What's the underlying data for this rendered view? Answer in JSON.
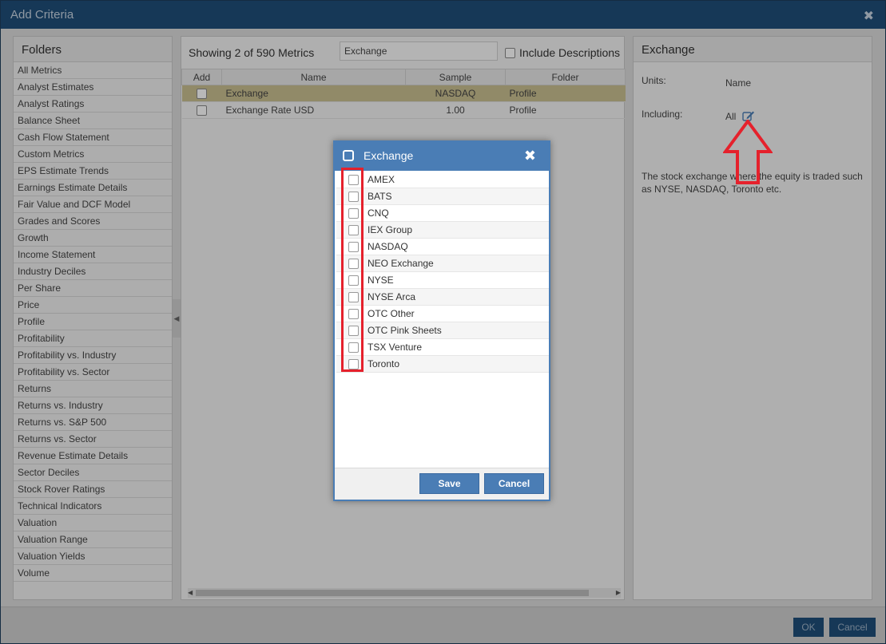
{
  "window": {
    "title": "Add Criteria"
  },
  "folders": {
    "title": "Folders",
    "items": [
      "All Metrics",
      "Analyst Estimates",
      "Analyst Ratings",
      "Balance Sheet",
      "Cash Flow Statement",
      "Custom Metrics",
      "EPS Estimate Trends",
      "Earnings Estimate Details",
      "Fair Value and DCF Model",
      "Grades and Scores",
      "Growth",
      "Income Statement",
      "Industry Deciles",
      "Per Share",
      "Price",
      "Profile",
      "Profitability",
      "Profitability vs. Industry",
      "Profitability vs. Sector",
      "Returns",
      "Returns vs. Industry",
      "Returns vs. S&P 500",
      "Returns vs. Sector",
      "Revenue Estimate Details",
      "Sector Deciles",
      "Stock Rover Ratings",
      "Technical Indicators",
      "Valuation",
      "Valuation Range",
      "Valuation Yields",
      "Volume"
    ]
  },
  "metrics": {
    "showing": "Showing 2 of 590 Metrics",
    "search_value": "Exchange",
    "include_descriptions": "Include Descriptions",
    "columns": {
      "add": "Add",
      "name": "Name",
      "sample": "Sample",
      "folder": "Folder"
    },
    "rows": [
      {
        "name": "Exchange",
        "sample": "NASDAQ",
        "folder": "Profile",
        "selected": true
      },
      {
        "name": "Exchange Rate USD",
        "sample": "1.00",
        "folder": "Profile",
        "selected": false
      }
    ]
  },
  "detail": {
    "title": "Exchange",
    "units_label": "Units:",
    "units_value": "Name",
    "including_label": "Including:",
    "including_value": "All",
    "description": "The stock exchange where the equity is traded such as NYSE, NASDAQ, Toronto etc."
  },
  "footer": {
    "ok": "OK",
    "cancel": "Cancel"
  },
  "modal": {
    "title": "Exchange",
    "options": [
      "AMEX",
      "BATS",
      "CNQ",
      "IEX Group",
      "NASDAQ",
      "NEO Exchange",
      "NYSE",
      "NYSE Arca",
      "OTC Other",
      "OTC Pink Sheets",
      "TSX Venture",
      "Toronto"
    ],
    "save": "Save",
    "cancel": "Cancel"
  },
  "colors": {
    "titlebar": "#1f4e79",
    "modal_header": "#4a7db5",
    "annotation": "#e5212c",
    "selected_row": "#c9bf91"
  }
}
